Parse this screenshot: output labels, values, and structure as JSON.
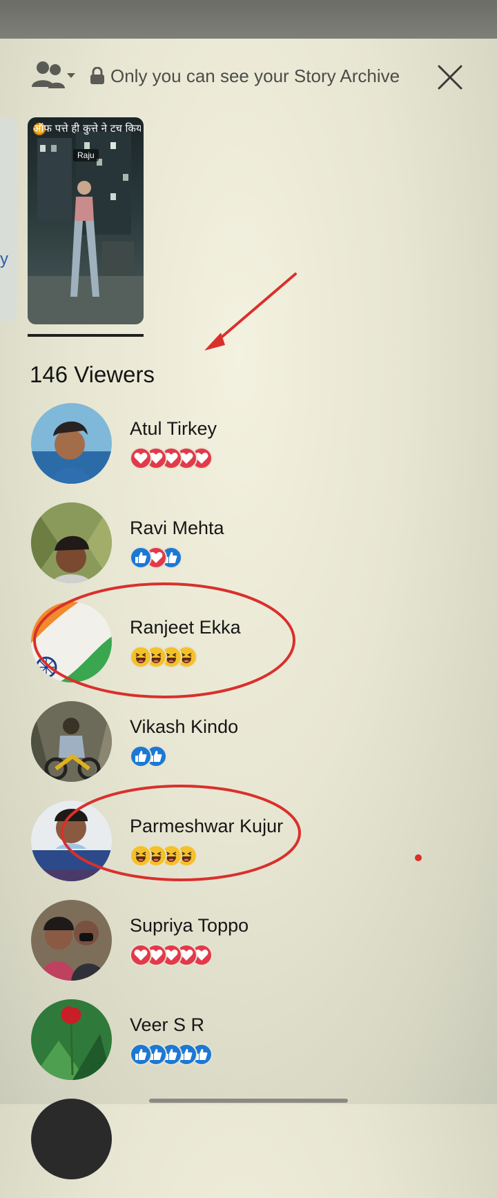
{
  "header": {
    "audience_icon": "people-dropdown-icon",
    "lock_icon": "lock-icon",
    "privacy_text": "Only you can see your Story Archive",
    "close_icon": "close-icon"
  },
  "left_card": {
    "text": "y"
  },
  "story_thumb": {
    "caption": "ऑफ पत्ते ही कुत्ते ने टच किया",
    "sub": "ऑफ पत्ते ही कुत्ते ने टच किया",
    "tag": "Raju"
  },
  "viewers": {
    "title": "146 Viewers",
    "items": [
      {
        "name": "Atul Tirkey",
        "reactions": [
          "love",
          "love",
          "love",
          "love",
          "love"
        ]
      },
      {
        "name": "Ravi Mehta",
        "reactions": [
          "like",
          "love",
          "like"
        ]
      },
      {
        "name": "Ranjeet Ekka",
        "reactions": [
          "haha",
          "haha",
          "haha",
          "haha"
        ]
      },
      {
        "name": "Vikash Kindo",
        "reactions": [
          "like",
          "like"
        ]
      },
      {
        "name": "Parmeshwar Kujur",
        "reactions": [
          "haha",
          "haha",
          "haha",
          "haha"
        ]
      },
      {
        "name": "Supriya Toppo",
        "reactions": [
          "love",
          "love",
          "love",
          "love",
          "love"
        ]
      },
      {
        "name": "Veer S R",
        "reactions": [
          "like",
          "like",
          "like",
          "like",
          "like"
        ]
      }
    ]
  },
  "colors": {
    "love": "#e23a4a",
    "like": "#1c78d4",
    "haha": "#f5c02a",
    "annotation": "#d9302c"
  }
}
